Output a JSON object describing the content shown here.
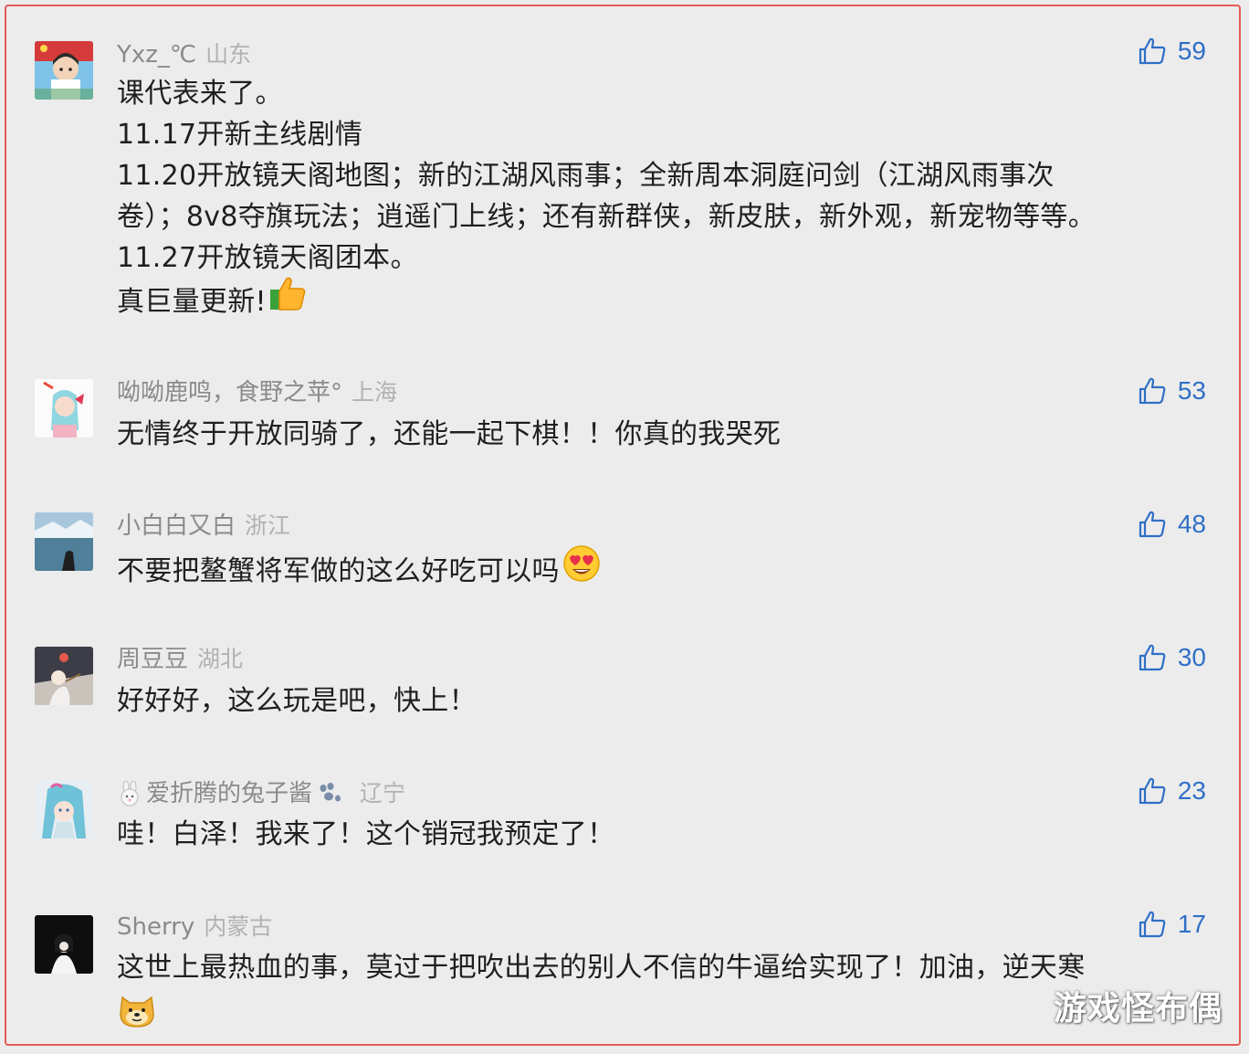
{
  "accent_color": "#2f6fc7",
  "border_color": "#e35b54",
  "like_icon": "thumbs-up-icon",
  "comments": [
    {
      "username": "Yxz_℃",
      "location": "山东",
      "likes": "59",
      "lines": [
        "课代表来了。",
        "11.17开新主线剧情",
        "11.20开放镜天阁地图；新的江湖风雨事；全新周本洞庭问剑（江湖风雨事次",
        "卷）；8v8夺旗玩法；逍遥门上线；还有新群侠，新皮肤，新外观，新宠物等等。",
        "11.27开放镜天阁团本。",
        "真巨量更新!"
      ],
      "trailing_emoji": "thumbs-up-emoji"
    },
    {
      "username": "呦呦鹿鸣，食野之苹°",
      "location": "上海",
      "likes": "53",
      "lines": [
        "无情终于开放同骑了，还能一起下棋！！你真的我哭死"
      ]
    },
    {
      "username": "小白白又白",
      "location": "浙江",
      "likes": "48",
      "lines": [
        "不要把鳌蟹将军做的这么好吃可以吗"
      ],
      "trailing_emoji": "heart-eyes-emoji"
    },
    {
      "username": "周豆豆",
      "location": "湖北",
      "likes": "30",
      "lines": [
        "好好好，这么玩是吧，快上！"
      ]
    },
    {
      "username": "爱折腾的兔子酱",
      "location": "辽宁",
      "likes": "23",
      "name_prefix_emoji": "rabbit-emoji",
      "name_suffix_emoji": "paw-emoji",
      "lines": [
        "哇！白泽！我来了！这个销冠我预定了！"
      ]
    },
    {
      "username": "Sherry",
      "location": "内蒙古",
      "likes": "17",
      "lines": [
        "这世上最热血的事，莫过于把吹出去的别人不信的牛逼给实现了！加油，逆天寒"
      ],
      "next_line_emoji": "doge-emoji"
    }
  ],
  "watermark": "游戏怪布偶"
}
